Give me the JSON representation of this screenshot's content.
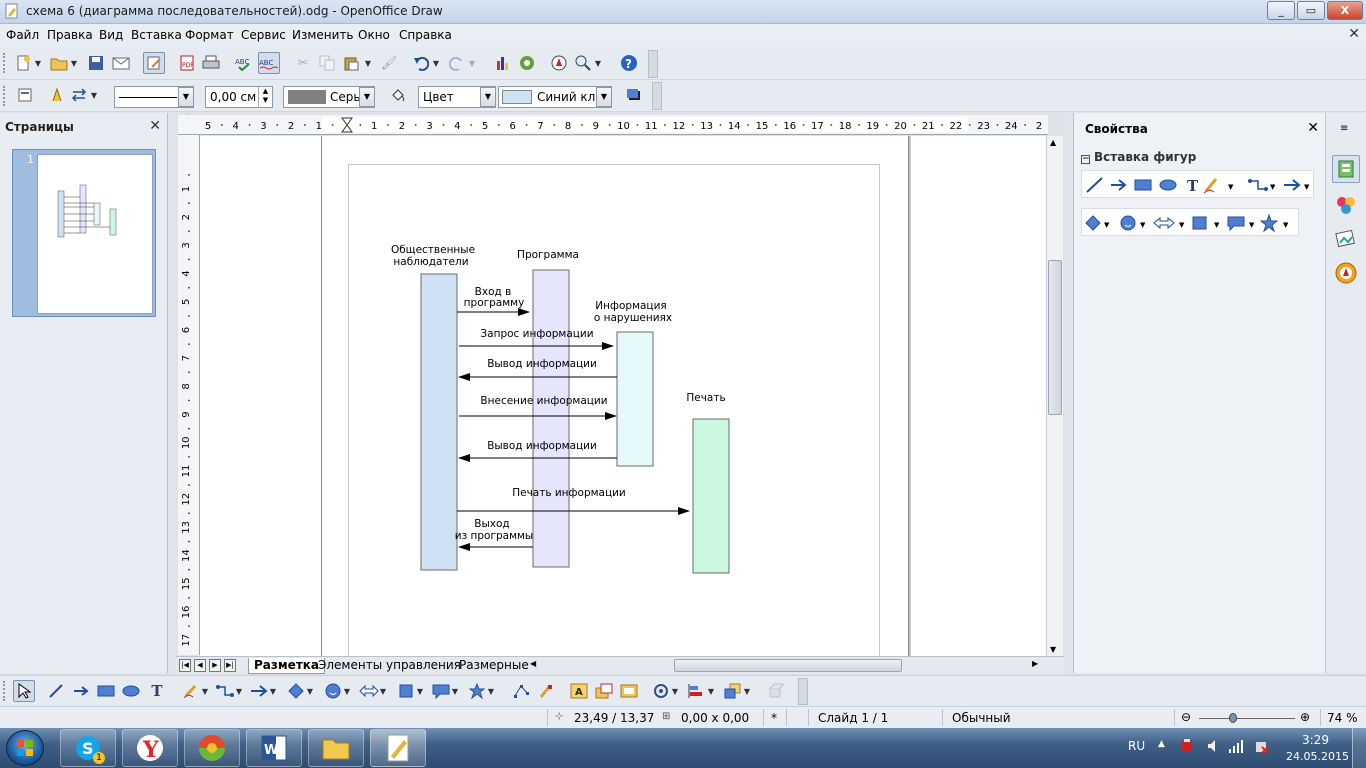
{
  "window": {
    "title": "схема 6 (диаграмма последовательностей).odg - OpenOffice Draw",
    "min": "_",
    "max": "▭",
    "close": "X"
  },
  "menu": [
    "Файл",
    "Правка",
    "Вид",
    "Вставка",
    "Формат",
    "Сервис",
    "Изменить",
    "Окно",
    "Справка"
  ],
  "toolbar2": {
    "line_width": "0,00 см",
    "line_color": "Серый",
    "area_style": "Цвет",
    "area_color": "Синий кла"
  },
  "pages_pane": {
    "title": "Страницы",
    "page_number": "1"
  },
  "ruler": {
    "h_labels": [
      "5",
      "4",
      "3",
      "2",
      "1",
      "",
      "1",
      "2",
      "3",
      "4",
      "5",
      "6",
      "7",
      "8",
      "9",
      "10",
      "11",
      "12",
      "13",
      "14",
      "15",
      "16",
      "17",
      "18",
      "19",
      "20",
      "21",
      "22",
      "23",
      "24",
      "2"
    ],
    "v_labels": [
      "1",
      "2",
      "3",
      "4",
      "5",
      "6",
      "7",
      "8",
      "9",
      "10",
      "11",
      "12",
      "13",
      "14",
      "15",
      "16",
      "17"
    ]
  },
  "diagram": {
    "lifelines": [
      {
        "label1": "Общественные",
        "label2": "наблюдатели",
        "color": "#cfe2f3"
      },
      {
        "label1": "Программа",
        "label2": "",
        "color": "#e5e5fb"
      },
      {
        "label1": "Информация",
        "label2": "о нарушениях",
        "color": "#e6f9fa"
      },
      {
        "label1": "Печать",
        "label2": "",
        "color": "#ccf8e2"
      }
    ],
    "messages": [
      {
        "line1": "Вход в",
        "line2": "программу"
      },
      {
        "line1": "Запрос информации",
        "line2": ""
      },
      {
        "line1": "Вывод информации",
        "line2": ""
      },
      {
        "line1": "Внесение информации",
        "line2": ""
      },
      {
        "line1": "Вывод информации",
        "line2": ""
      },
      {
        "line1": "Печать информации",
        "line2": ""
      },
      {
        "line1": "Выход",
        "line2": "из программы"
      }
    ]
  },
  "tabs": [
    "Разметка",
    "Элементы управления",
    "Размерные"
  ],
  "properties": {
    "title": "Свойства",
    "section": "Вставка фигур"
  },
  "status": {
    "position": "23,49 / 13,37",
    "size": "0,00 x 0,00",
    "modified": "*",
    "slide": "Слайд 1 / 1",
    "layout": "Обычный",
    "zoom": "74 %"
  },
  "taskbar": {
    "lang": "RU",
    "time": "3:29",
    "date": "24.05.2015",
    "skype_badge": "1"
  }
}
